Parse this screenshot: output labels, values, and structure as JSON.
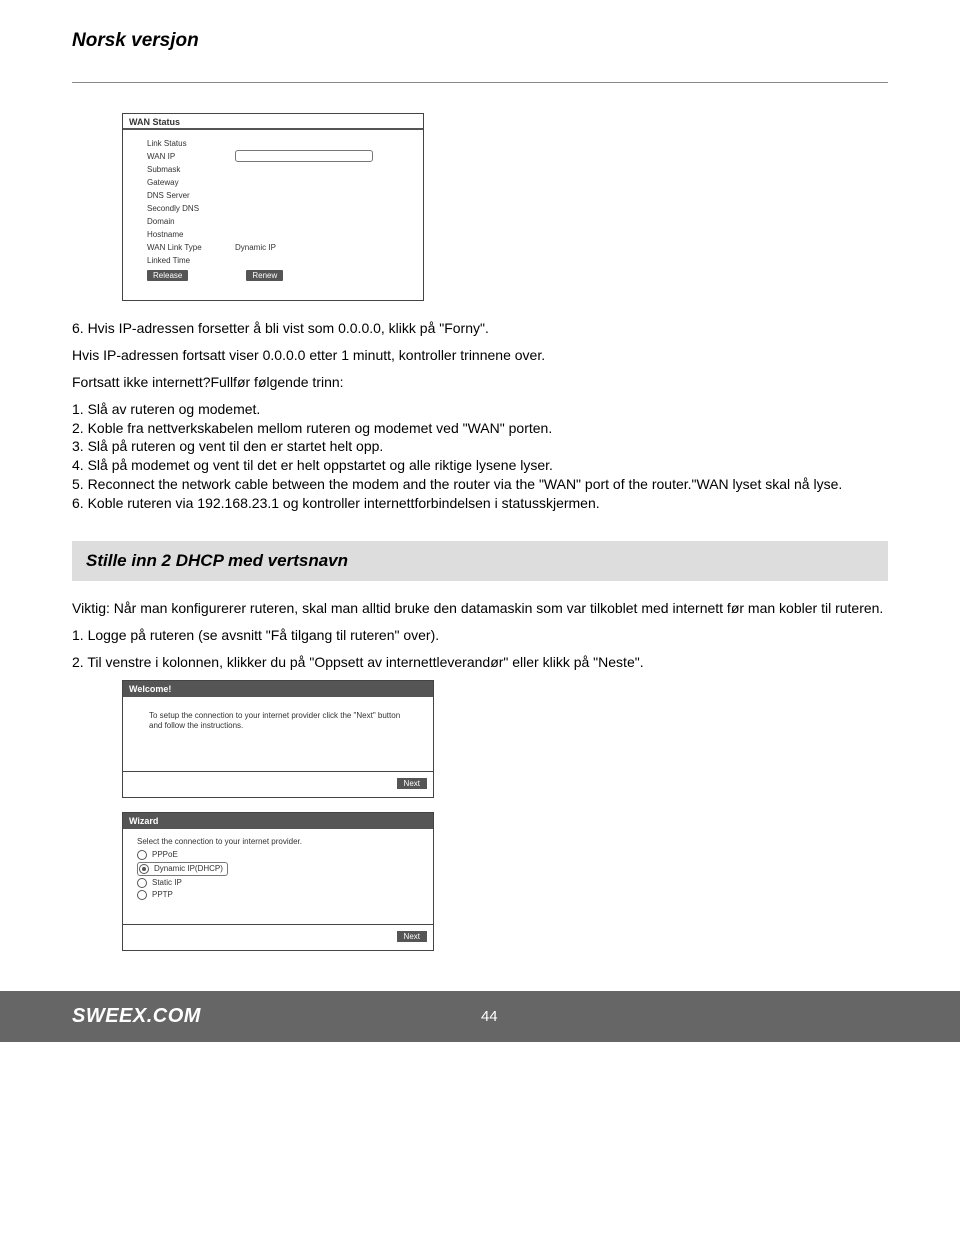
{
  "header": {
    "version_title": "Norsk versjon"
  },
  "wan_status": {
    "title": "WAN Status",
    "rows": {
      "link_status": "Link Status",
      "wan_ip": "WAN IP",
      "submask": "Submask",
      "gateway": "Gateway",
      "dns_server": "DNS Server",
      "secondly_dns": "Secondly DNS",
      "domain": "Domain",
      "hostname": "Hostname",
      "wan_link_type": "WAN Link Type",
      "wan_link_type_val": "Dynamic IP",
      "linked_time": "Linked Time"
    },
    "buttons": {
      "release": "Release",
      "renew": "Renew"
    }
  },
  "text1": {
    "l6": "6.  Hvis IP-adressen forsetter å bli vist som 0.0.0.0, klikk på \"Forny\".",
    "p1": "Hvis IP-adressen fortsatt viser 0.0.0.0 etter 1 minutt, kontroller trinnene over.",
    "p2": "Fortsatt ikke internett?Fullfør følgende trinn:",
    "s1": "1.  Slå av ruteren og modemet.",
    "s2": "2.  Koble fra nettverkskabelen mellom ruteren og modemet ved \"WAN\" porten.",
    "s3": "3.  Slå på ruteren og vent til den er startet helt opp.",
    "s4": "4.  Slå på modemet og vent til det er helt oppstartet og alle riktige lysene lyser.",
    "s5": "5.  Reconnect the network cable between the modem and the router via the \"WAN\" port of the router.\"WAN lyset skal nå lyse.",
    "s6": "6.  Koble ruteren via 192.168.23.1 og kontroller internettforbindelsen i statusskjermen."
  },
  "section2": {
    "title": "Stille inn 2 DHCP med vertsnavn",
    "p1": "Viktig: Når man konfigurerer ruteren, skal man alltid bruke den datamaskin som var tilkoblet med internett før man kobler til ruteren.",
    "p2": "1. Logge på ruteren (se avsnitt \"Få tilgang til ruteren\" over).",
    "p3": "2. Til venstre i kolonnen, klikker du på \"Oppsett av internettleverandør\" eller klikk på \"Neste\"."
  },
  "welcome": {
    "title": "Welcome!",
    "text": "To setup the connection to your internet provider click the \"Next\" button and follow the instructions.",
    "next": "Next"
  },
  "wizard": {
    "title": "Wizard",
    "instruction": "Select the connection to your internet provider.",
    "options": {
      "pppoe": "PPPoE",
      "dhcp": "Dynamic IP(DHCP)",
      "static": "Static IP",
      "pptp": "PPTP"
    },
    "next": "Next"
  },
  "footer": {
    "brand": "SWEEX.COM",
    "page": "44"
  }
}
